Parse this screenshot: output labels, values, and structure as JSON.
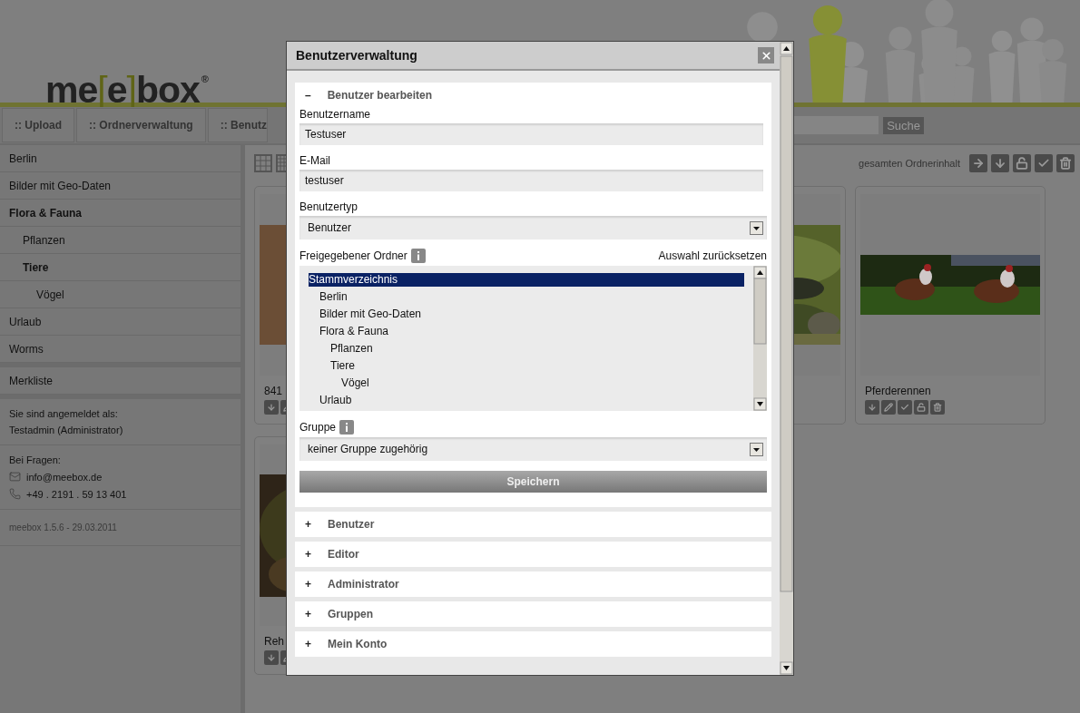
{
  "header": {
    "logo": {
      "before": "me",
      "open": "[",
      "inner": "e",
      "close": "]",
      "after": "box",
      "mark": "®"
    }
  },
  "nav": {
    "tabs": [
      {
        "label": ":: Upload",
        "selected": false
      },
      {
        "label": ":: Ordnerverwaltung",
        "selected": false
      },
      {
        "label": ":: Benutz",
        "selected": false
      }
    ],
    "search": {
      "button": "Suche"
    }
  },
  "sidebar": {
    "folders": [
      {
        "label": "Berlin",
        "active": false
      },
      {
        "label": "Bilder mit Geo-Daten",
        "active": false
      },
      {
        "label": "Flora & Fauna",
        "active": true,
        "children": [
          {
            "label": "Pflanzen",
            "active": false
          },
          {
            "label": "Tiere",
            "active": true,
            "children": [
              {
                "label": "Vögel",
                "active": false
              }
            ]
          }
        ]
      },
      {
        "label": "Urlaub",
        "active": false
      },
      {
        "label": "Worms",
        "active": false
      }
    ],
    "bookmarks": "Merkliste",
    "login": {
      "heading": "Sie sind angemeldet als:",
      "user": "Testadmin (Administrator)"
    },
    "contact": {
      "heading": "Bei Fragen:",
      "email": "info@meebox.de",
      "phone": "+49 . 2191 . 59 13 401"
    },
    "version": "meebox 1.5.6 - 29.03.2011"
  },
  "toolbar": {
    "views": [
      {
        "kind": "grid"
      },
      {
        "kind": "list"
      }
    ],
    "bulk_label": "gesamten Ordnerinhalt",
    "bulk_actions": [
      {
        "kind": "move"
      },
      {
        "kind": "download"
      },
      {
        "kind": "unlock"
      },
      {
        "kind": "approve"
      },
      {
        "kind": "delete"
      }
    ]
  },
  "cards": [
    {
      "kind": "picture",
      "title": "841",
      "actions": [
        {
          "kind": "download"
        },
        {
          "kind": "edit"
        }
      ]
    },
    {
      "kind": "picture"
    },
    {
      "kind": "picture",
      "title": "Pferderennen",
      "actions": [
        {
          "kind": "download"
        },
        {
          "kind": "edit"
        },
        {
          "kind": "approve"
        },
        {
          "kind": "unlock"
        },
        {
          "kind": "delete"
        }
      ]
    },
    {
      "kind": "picture",
      "title": "Reh",
      "actions": [
        {
          "kind": "download"
        },
        {
          "kind": "edit"
        }
      ]
    }
  ],
  "modal": {
    "title": "Benutzerverwaltung",
    "sections": [
      {
        "toggle": "–",
        "title": "Benutzer bearbeiten",
        "expanded": true
      },
      {
        "toggle": "+",
        "title": "Benutzer",
        "expanded": false
      },
      {
        "toggle": "+",
        "title": "Editor",
        "expanded": false
      },
      {
        "toggle": "+",
        "title": "Administrator",
        "expanded": false
      },
      {
        "toggle": "+",
        "title": "Gruppen",
        "expanded": false
      },
      {
        "toggle": "+",
        "title": "Mein Konto",
        "expanded": false
      }
    ],
    "form": {
      "fields": [
        {
          "kind": "text",
          "label": "Benutzername",
          "value": "Testuser"
        },
        {
          "kind": "text",
          "label": "E-Mail",
          "value": "testuser"
        },
        {
          "kind": "select",
          "label": "Benutzertyp",
          "value": "Benutzer"
        },
        {
          "kind": "tree",
          "label": "Freigegebener Ordner",
          "info": true,
          "action": "Auswahl zurücksetzen",
          "items": [
            {
              "label": "Stammverzeichnis",
              "selected": true,
              "children": [
                {
                  "label": "Berlin",
                  "selected": false
                },
                {
                  "label": "Bilder mit Geo-Daten",
                  "selected": false
                },
                {
                  "label": "Flora & Fauna",
                  "selected": false,
                  "children": [
                    {
                      "label": "Pflanzen",
                      "selected": false
                    },
                    {
                      "label": "Tiere",
                      "selected": false,
                      "children": [
                        {
                          "label": "Vögel",
                          "selected": false
                        }
                      ]
                    }
                  ]
                },
                {
                  "label": "Urlaub",
                  "selected": false
                }
              ]
            }
          ]
        },
        {
          "kind": "select",
          "label": "Gruppe",
          "info": true,
          "value": "keiner Gruppe zugehörig"
        }
      ],
      "save_button": "Speichern"
    }
  }
}
